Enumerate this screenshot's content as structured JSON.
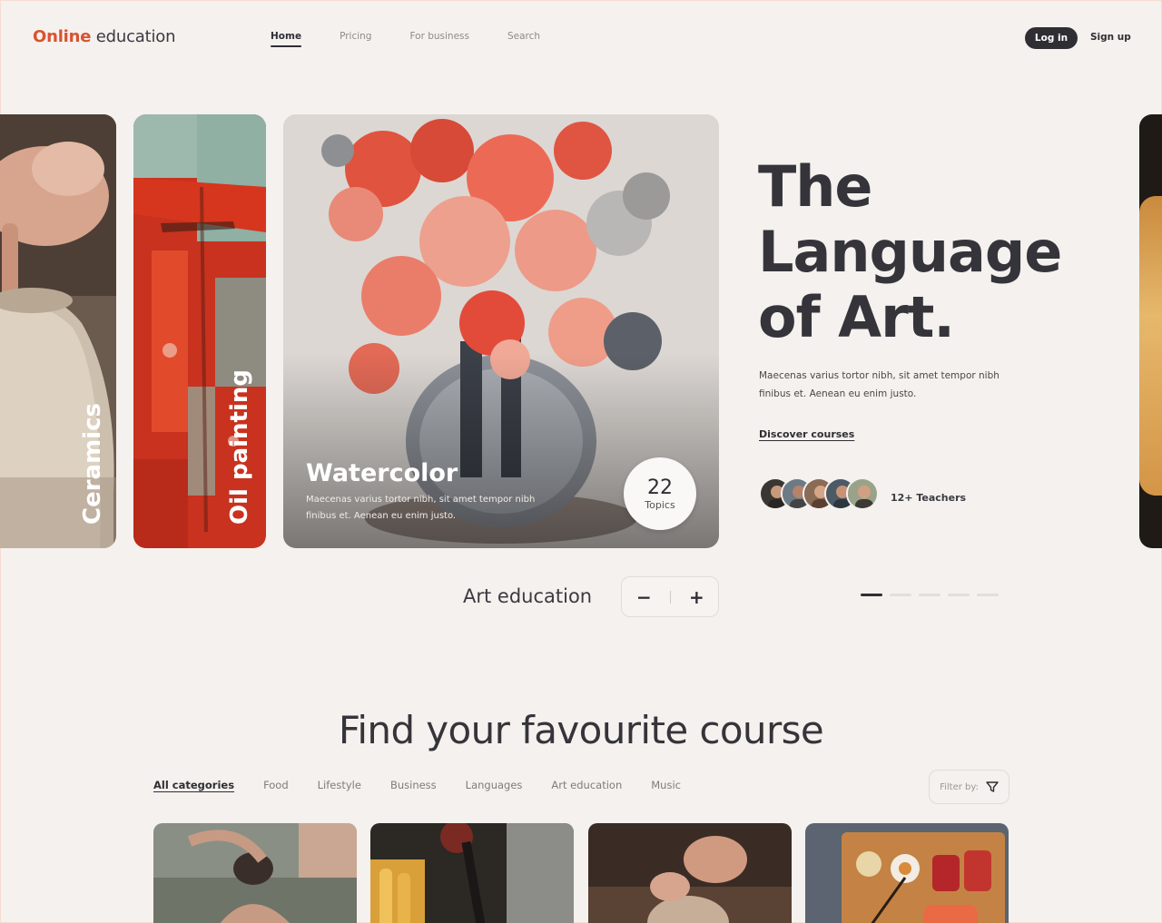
{
  "header": {
    "logo_brand": "Online",
    "logo_rest": " education",
    "nav": [
      "Home",
      "Pricing",
      "For business",
      "Search"
    ],
    "login": "Log in",
    "signup": "Sign up"
  },
  "hero": {
    "cards": {
      "ceramics": "Ceramics",
      "oil": "Oil painting",
      "watercolor": {
        "title": "Watercolor",
        "desc": "Maecenas varius tortor nibh, sit amet tempor nibh finibus et. Aenean eu enim justo.",
        "topics_num": "22",
        "topics_label": "Topics"
      }
    },
    "title_lines": [
      "The",
      "Language",
      "of Art."
    ],
    "desc": "Maecenas varius tortor nibh, sit amet tempor nibh finibus et. Aenean eu enim justo.",
    "discover": "Discover courses",
    "teachers": "12+ Teachers"
  },
  "controls": {
    "label": "Art education",
    "minus": "−",
    "plus": "+",
    "slide_active": 1,
    "slide_count": 5
  },
  "courses": {
    "title": "Find your favourite course",
    "categories": [
      "All categories",
      "Food",
      "Lifestyle",
      "Business",
      "Languages",
      "Art education",
      "Music"
    ],
    "filter": "Filter by:"
  },
  "colors": {
    "accent": "#d9532f",
    "dark": "#2f2e33",
    "background": "#f4f1ee"
  }
}
